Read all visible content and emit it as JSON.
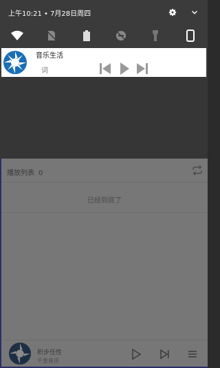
{
  "status_bar": {
    "time_date": "上午10:21 • 7月28日周四",
    "settings_icon": "gear-icon",
    "expand_icon": "chevron-down-icon"
  },
  "quick_settings": [
    {
      "name": "wifi",
      "icon": "wifi-icon"
    },
    {
      "name": "no-sim",
      "icon": "sim-off-icon"
    },
    {
      "name": "battery",
      "icon": "battery-icon"
    },
    {
      "name": "do-not-disturb",
      "icon": "dnd-off-icon"
    },
    {
      "name": "flashlight",
      "icon": "flashlight-icon"
    },
    {
      "name": "rotation",
      "icon": "phone-portrait-icon"
    }
  ],
  "notification": {
    "app_name": "音乐生活",
    "lyric_label": "词",
    "controls": [
      "previous-icon",
      "play-icon",
      "next-icon"
    ]
  },
  "playlist": {
    "title": "播放列表",
    "count": "0",
    "empty_text": "已经到底了",
    "loop_icon": "repeat-icon"
  },
  "now_playing": {
    "song": "积步任性",
    "artist": "千金音乐",
    "controls": [
      "play-icon",
      "next-icon",
      "playlist-icon"
    ]
  },
  "colors": {
    "shade": "#3b3b3b",
    "notification_bg": "#ffffff",
    "logo_blue": "#1a6fb8",
    "playlist_bg": "#777777",
    "accent_line": "#2b2f66"
  }
}
